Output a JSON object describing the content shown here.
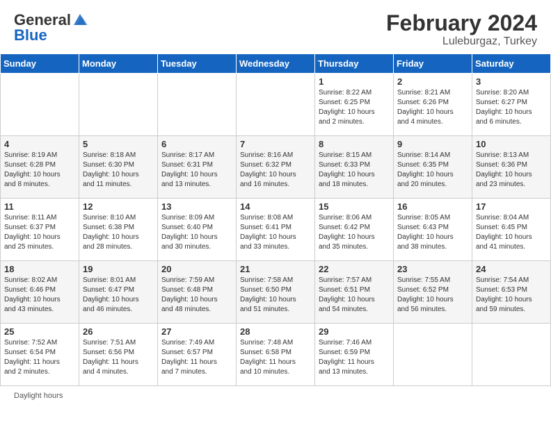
{
  "header": {
    "logo_general": "General",
    "logo_blue": "Blue",
    "title": "February 2024",
    "subtitle": "Luleburgaz, Turkey"
  },
  "days_of_week": [
    "Sunday",
    "Monday",
    "Tuesday",
    "Wednesday",
    "Thursday",
    "Friday",
    "Saturday"
  ],
  "footer": {
    "daylight_hours": "Daylight hours"
  },
  "weeks": [
    {
      "days": [
        {
          "num": "",
          "info": ""
        },
        {
          "num": "",
          "info": ""
        },
        {
          "num": "",
          "info": ""
        },
        {
          "num": "",
          "info": ""
        },
        {
          "num": "1",
          "info": "Sunrise: 8:22 AM\nSunset: 6:25 PM\nDaylight: 10 hours\nand 2 minutes."
        },
        {
          "num": "2",
          "info": "Sunrise: 8:21 AM\nSunset: 6:26 PM\nDaylight: 10 hours\nand 4 minutes."
        },
        {
          "num": "3",
          "info": "Sunrise: 8:20 AM\nSunset: 6:27 PM\nDaylight: 10 hours\nand 6 minutes."
        }
      ]
    },
    {
      "days": [
        {
          "num": "4",
          "info": "Sunrise: 8:19 AM\nSunset: 6:28 PM\nDaylight: 10 hours\nand 8 minutes."
        },
        {
          "num": "5",
          "info": "Sunrise: 8:18 AM\nSunset: 6:30 PM\nDaylight: 10 hours\nand 11 minutes."
        },
        {
          "num": "6",
          "info": "Sunrise: 8:17 AM\nSunset: 6:31 PM\nDaylight: 10 hours\nand 13 minutes."
        },
        {
          "num": "7",
          "info": "Sunrise: 8:16 AM\nSunset: 6:32 PM\nDaylight: 10 hours\nand 16 minutes."
        },
        {
          "num": "8",
          "info": "Sunrise: 8:15 AM\nSunset: 6:33 PM\nDaylight: 10 hours\nand 18 minutes."
        },
        {
          "num": "9",
          "info": "Sunrise: 8:14 AM\nSunset: 6:35 PM\nDaylight: 10 hours\nand 20 minutes."
        },
        {
          "num": "10",
          "info": "Sunrise: 8:13 AM\nSunset: 6:36 PM\nDaylight: 10 hours\nand 23 minutes."
        }
      ]
    },
    {
      "days": [
        {
          "num": "11",
          "info": "Sunrise: 8:11 AM\nSunset: 6:37 PM\nDaylight: 10 hours\nand 25 minutes."
        },
        {
          "num": "12",
          "info": "Sunrise: 8:10 AM\nSunset: 6:38 PM\nDaylight: 10 hours\nand 28 minutes."
        },
        {
          "num": "13",
          "info": "Sunrise: 8:09 AM\nSunset: 6:40 PM\nDaylight: 10 hours\nand 30 minutes."
        },
        {
          "num": "14",
          "info": "Sunrise: 8:08 AM\nSunset: 6:41 PM\nDaylight: 10 hours\nand 33 minutes."
        },
        {
          "num": "15",
          "info": "Sunrise: 8:06 AM\nSunset: 6:42 PM\nDaylight: 10 hours\nand 35 minutes."
        },
        {
          "num": "16",
          "info": "Sunrise: 8:05 AM\nSunset: 6:43 PM\nDaylight: 10 hours\nand 38 minutes."
        },
        {
          "num": "17",
          "info": "Sunrise: 8:04 AM\nSunset: 6:45 PM\nDaylight: 10 hours\nand 41 minutes."
        }
      ]
    },
    {
      "days": [
        {
          "num": "18",
          "info": "Sunrise: 8:02 AM\nSunset: 6:46 PM\nDaylight: 10 hours\nand 43 minutes."
        },
        {
          "num": "19",
          "info": "Sunrise: 8:01 AM\nSunset: 6:47 PM\nDaylight: 10 hours\nand 46 minutes."
        },
        {
          "num": "20",
          "info": "Sunrise: 7:59 AM\nSunset: 6:48 PM\nDaylight: 10 hours\nand 48 minutes."
        },
        {
          "num": "21",
          "info": "Sunrise: 7:58 AM\nSunset: 6:50 PM\nDaylight: 10 hours\nand 51 minutes."
        },
        {
          "num": "22",
          "info": "Sunrise: 7:57 AM\nSunset: 6:51 PM\nDaylight: 10 hours\nand 54 minutes."
        },
        {
          "num": "23",
          "info": "Sunrise: 7:55 AM\nSunset: 6:52 PM\nDaylight: 10 hours\nand 56 minutes."
        },
        {
          "num": "24",
          "info": "Sunrise: 7:54 AM\nSunset: 6:53 PM\nDaylight: 10 hours\nand 59 minutes."
        }
      ]
    },
    {
      "days": [
        {
          "num": "25",
          "info": "Sunrise: 7:52 AM\nSunset: 6:54 PM\nDaylight: 11 hours\nand 2 minutes."
        },
        {
          "num": "26",
          "info": "Sunrise: 7:51 AM\nSunset: 6:56 PM\nDaylight: 11 hours\nand 4 minutes."
        },
        {
          "num": "27",
          "info": "Sunrise: 7:49 AM\nSunset: 6:57 PM\nDaylight: 11 hours\nand 7 minutes."
        },
        {
          "num": "28",
          "info": "Sunrise: 7:48 AM\nSunset: 6:58 PM\nDaylight: 11 hours\nand 10 minutes."
        },
        {
          "num": "29",
          "info": "Sunrise: 7:46 AM\nSunset: 6:59 PM\nDaylight: 11 hours\nand 13 minutes."
        },
        {
          "num": "",
          "info": ""
        },
        {
          "num": "",
          "info": ""
        }
      ]
    }
  ]
}
